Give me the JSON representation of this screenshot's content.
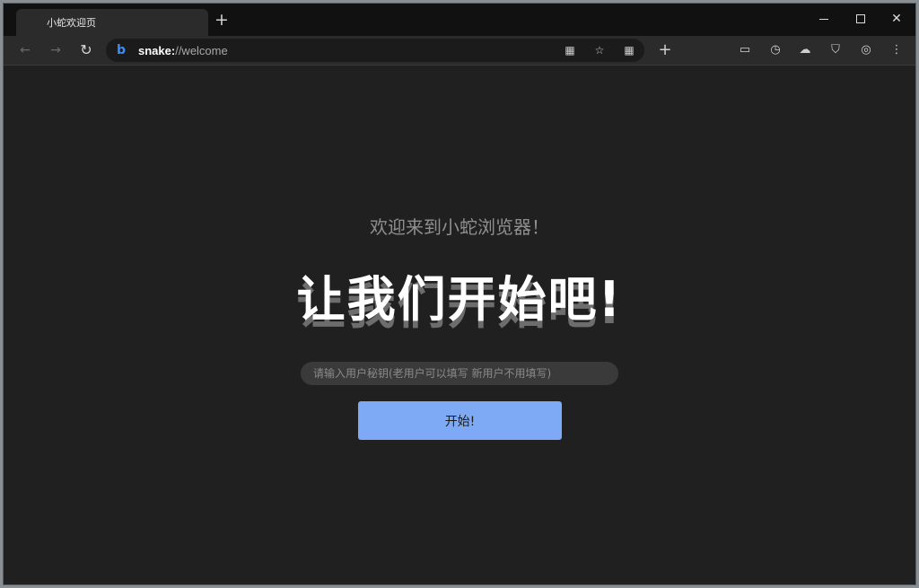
{
  "tab": {
    "title": "小蛇欢迎页"
  },
  "toolbar": {
    "url_scheme": "snake:",
    "url_rest": "//welcome"
  },
  "icons": {
    "back": "←",
    "forward": "→",
    "reload": "↻",
    "new_tab": "+",
    "close": "✕",
    "bing": "b",
    "qr": "▦",
    "favorite": "☆",
    "apps": "▦",
    "add": "+",
    "collections": "▭",
    "history": "◷",
    "cloud": "☁",
    "shield": "⛉",
    "profile": "◎",
    "menu": "⋮"
  },
  "main": {
    "welcome_text": "欢迎来到小蛇浏览器！",
    "headline": "让我们开始吧!",
    "input_placeholder": "请输入用户秘钥(老用户可以填写 新用户不用填写)",
    "start_label": "开始!"
  },
  "colors": {
    "accent": "#7ea9f5",
    "bing": "#3a8ef6"
  }
}
